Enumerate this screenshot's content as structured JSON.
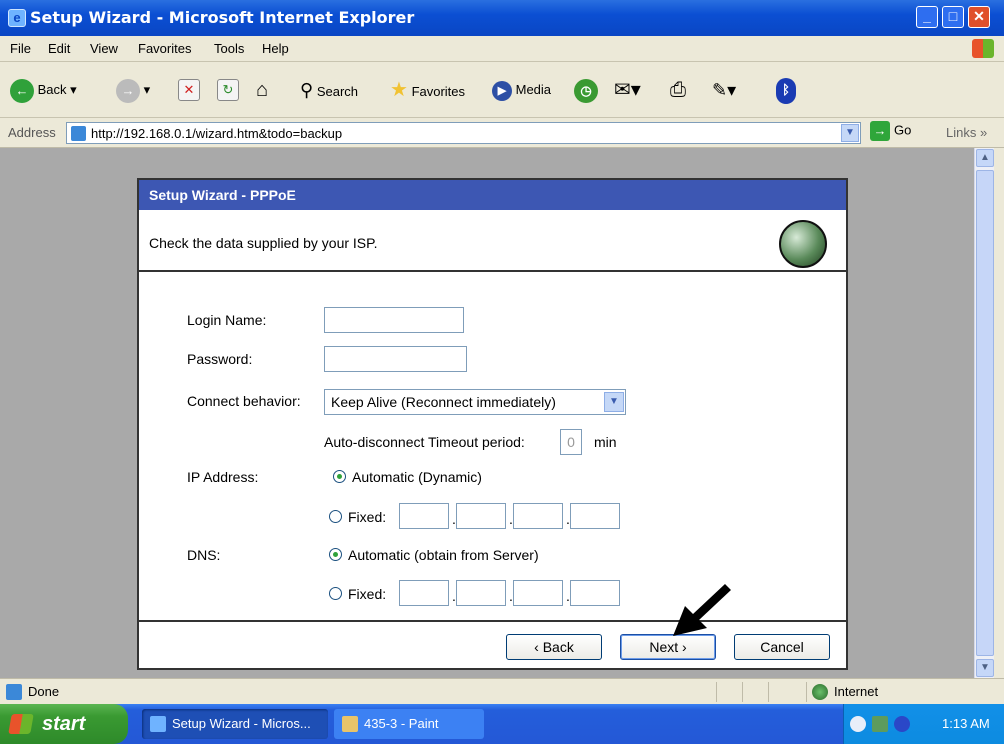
{
  "window": {
    "title": "Setup Wizard - Microsoft Internet Explorer",
    "controls": {
      "minimize": "_",
      "maximize": "□",
      "close": "✕"
    }
  },
  "menu": [
    "File",
    "Edit",
    "View",
    "Favorites",
    "Tools",
    "Help"
  ],
  "toolbar": {
    "back": "Back",
    "search": "Search",
    "favorites": "Favorites",
    "media": "Media"
  },
  "address": {
    "label": "Address",
    "url": "http://192.168.0.1/wizard.htm&todo=backup",
    "go": "Go",
    "links": "Links"
  },
  "wizard": {
    "title": "Setup Wizard - PPPoE",
    "intro": "Check the data supplied by your ISP.",
    "login_label": "Login Name:",
    "login_value": "",
    "password_label": "Password:",
    "password_value": "",
    "connect_label": "Connect behavior:",
    "connect_value": "Keep Alive (Reconnect immediately)",
    "timeout_label": "Auto-disconnect Timeout period:",
    "timeout_value": "0",
    "timeout_unit": "min",
    "ip_label": "IP Address:",
    "ip_auto": "Automatic (Dynamic)",
    "ip_fixed": "Fixed:",
    "dns_label": "DNS:",
    "dns_auto": "Automatic (obtain from Server)",
    "dns_fixed": "Fixed:",
    "back_btn": "‹ Back",
    "next_btn": "Next ›",
    "cancel_btn": "Cancel",
    "ip_mode": "automatic",
    "dns_mode": "automatic"
  },
  "status": {
    "text": "Done",
    "zone": "Internet"
  },
  "taskbar": {
    "start": "start",
    "tasks": [
      "Setup Wizard - Micros...",
      "435-3 - Paint"
    ],
    "clock": "1:13 AM"
  }
}
